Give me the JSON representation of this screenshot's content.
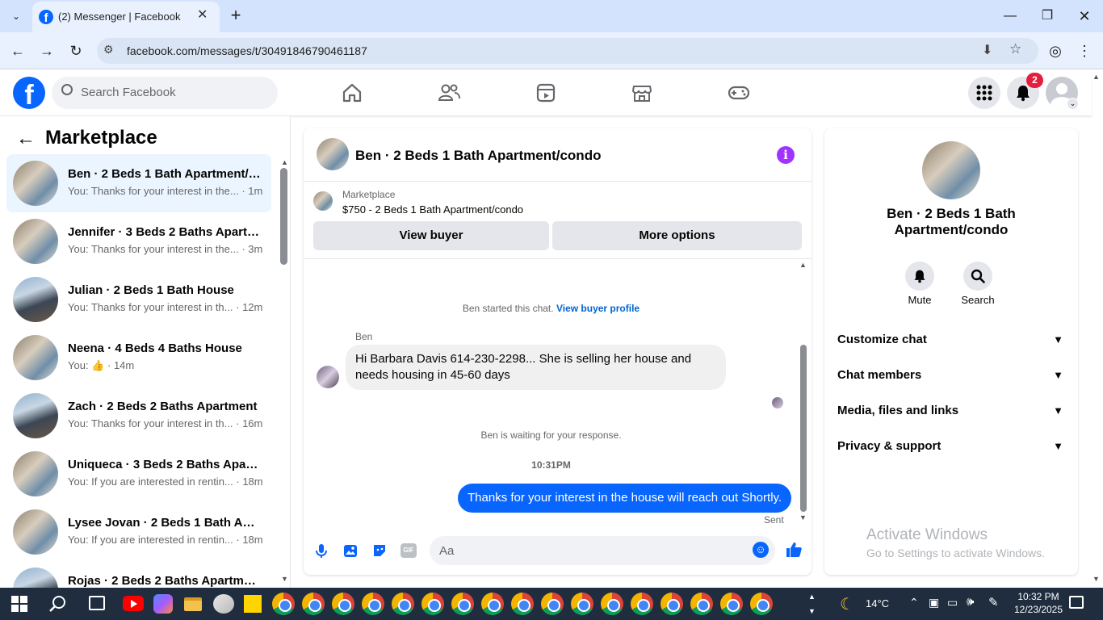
{
  "browser": {
    "tab_title": "(2) Messenger | Facebook",
    "url": "facebook.com/messages/t/30491846790461187"
  },
  "fb": {
    "search_placeholder": "Search Facebook",
    "notif_count": "2",
    "brand_color": "#0866ff"
  },
  "sidebar": {
    "title": "Marketplace",
    "conversations": [
      {
        "name": "Ben · 2 Beds 1 Bath Apartment/condo",
        "preview": "You: Thanks for your interest in the...",
        "time": "· 1m",
        "thumb": "room"
      },
      {
        "name": "Jennifer · 3 Beds 2 Baths Apartment",
        "preview": "You: Thanks for your interest in the...",
        "time": "· 3m",
        "thumb": "room"
      },
      {
        "name": "Julian · 2 Beds 1 Bath House",
        "preview": "You: Thanks for your interest in th...",
        "time": "· 12m",
        "thumb": "house"
      },
      {
        "name": "Neena · 4 Beds 4 Baths House",
        "preview": "You:",
        "time": "· 14m",
        "thumb": "room"
      },
      {
        "name": "Zach · 2 Beds 2 Baths Apartment",
        "preview": "You: Thanks for your interest in th...",
        "time": "· 16m",
        "thumb": "house"
      },
      {
        "name": "Uniqueca · 3 Beds 2 Baths Apartment",
        "preview": "You: If you are interested in rentin...",
        "time": "· 18m",
        "thumb": "room"
      },
      {
        "name": "Lysee Jovan · 2 Beds 1 Bath Apartment",
        "preview": "You: If you are interested in rentin...",
        "time": "· 18m",
        "thumb": "room"
      },
      {
        "name": "Rojas · 2 Beds 2 Baths Apartment",
        "preview": "",
        "time": "",
        "thumb": "house"
      }
    ]
  },
  "chat": {
    "title": "Ben · 2 Beds 1 Bath Apartment/condo",
    "listing_source": "Marketplace",
    "listing_title": "$750 - 2 Beds 1 Bath Apartment/condo",
    "view_buyer": "View buyer",
    "more_options": "More options",
    "started_text": "Ben started this chat.",
    "view_profile": "View buyer profile",
    "sender": "Ben",
    "incoming_message": "Hi Barbara Davis 614-230-2298... She is selling her house and needs housing in 45-60 days",
    "waiting_text": "Ben is waiting for your response.",
    "timestamp": "10:31PM",
    "outgoing_message": "Thanks for your interest in the house will reach out Shortly.",
    "status": "Sent",
    "input_placeholder": "Aa",
    "gif_label": "GIF"
  },
  "details": {
    "name": "Ben · 2 Beds 1 Bath Apartment/condo",
    "mute_label": "Mute",
    "search_label": "Search",
    "sections": [
      "Customize chat",
      "Chat members",
      "Media, files and links",
      "Privacy & support"
    ]
  },
  "watermark": {
    "title": "Activate Windows",
    "subtitle": "Go to Settings to activate Windows."
  },
  "taskbar": {
    "temperature": "14°C",
    "time": "10:32 PM",
    "date": "12/23/2025"
  }
}
